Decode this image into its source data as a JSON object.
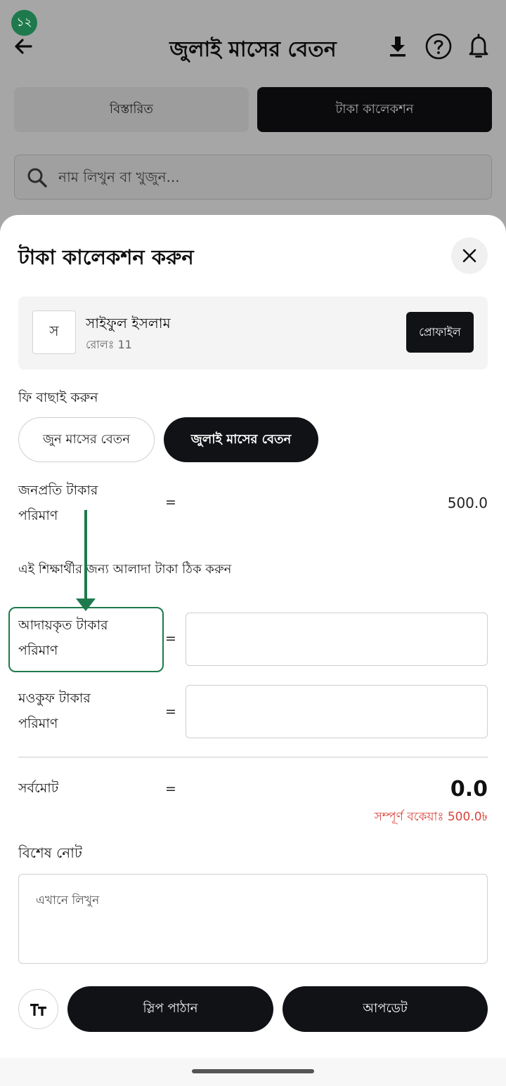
{
  "step_badge": "১২",
  "appbar": {
    "title": "জুলাই মাসের বেতন",
    "icons": [
      "back-arrow-icon",
      "download-icon",
      "help-icon",
      "bell-icon"
    ]
  },
  "tabs": [
    {
      "label": "বিস্তারিত",
      "active": false
    },
    {
      "label": "টাকা কালেকশন",
      "active": true
    }
  ],
  "search": {
    "placeholder": "নাম লিখুন বা খুজুন..."
  },
  "sheet": {
    "title": "টাকা কালেকশন করুন",
    "student": {
      "avatar_letter": "স",
      "name": "সাইফুল ইসলাম",
      "roll": "রোলঃ 11",
      "profile_button": "প্রোফাইল"
    },
    "fee_select_label": "ফি বাছাই করুন",
    "fee_options": [
      {
        "label": "জুন মাসের বেতন",
        "selected": false
      },
      {
        "label": "জুলাই মাসের বেতন",
        "selected": true
      }
    ],
    "per_person": {
      "label_line1": "জনপ্রতি টাকার",
      "label_line2": "পরিমাণ",
      "eq": "=",
      "value": "500.0"
    },
    "separate_amount_note": "এই শিক্ষার্থীর জন্য আলাদা টাকা ঠিক করুন",
    "collected": {
      "label_line1": "আদায়কৃত টাকার",
      "label_line2": "পরিমাণ",
      "eq": "=",
      "value": ""
    },
    "waived": {
      "label_line1": "মওকুফ টাকার",
      "label_line2": "পরিমাণ",
      "eq": "=",
      "value": ""
    },
    "total": {
      "label": "সর্বমোট",
      "eq": "=",
      "value": "0.0",
      "due": "সম্পূর্ণ বকেয়াঃ 500.0৳"
    },
    "note": {
      "label": "বিশেষ নোট",
      "placeholder": "এখানে লিখুন"
    },
    "buttons": {
      "font_size_icon": "text-size-icon",
      "send_slip": "স্লিপ পাঠান",
      "update": "আপডেট"
    }
  },
  "colors": {
    "primary_dark": "#111216",
    "annotation_green": "#1e7a4c",
    "due_red": "#d9433a"
  }
}
